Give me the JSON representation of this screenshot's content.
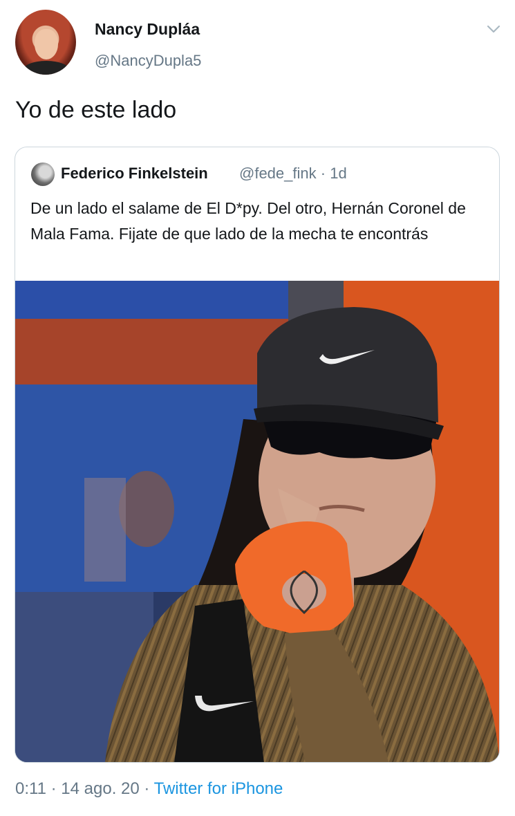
{
  "tweet": {
    "author_name": "Nancy Dupláa",
    "author_handle": "@NancyDupla5",
    "text": "Yo de este lado",
    "time": "0:11",
    "separator": "·",
    "date": "14 ago. 20",
    "source": "Twitter for iPhone",
    "menu_icon": "chevron-down-icon"
  },
  "quoted_tweet": {
    "author_name": "Federico Finkelstein",
    "author_handle": "@fede_fink",
    "separator": "·",
    "age": "1d",
    "text": "De un lado el salame de El D*py. Del otro, Hernán Coronel de Mala Fama. Fijate de que lado de la mecha te encontrás",
    "media": "photo of a person in a black cap, dark sunglasses and orange fingerless glove resting chin on hand"
  },
  "colors": {
    "text_primary": "#14171a",
    "text_secondary": "#657786",
    "link": "#1b95e0",
    "border": "#ccd6dd"
  }
}
